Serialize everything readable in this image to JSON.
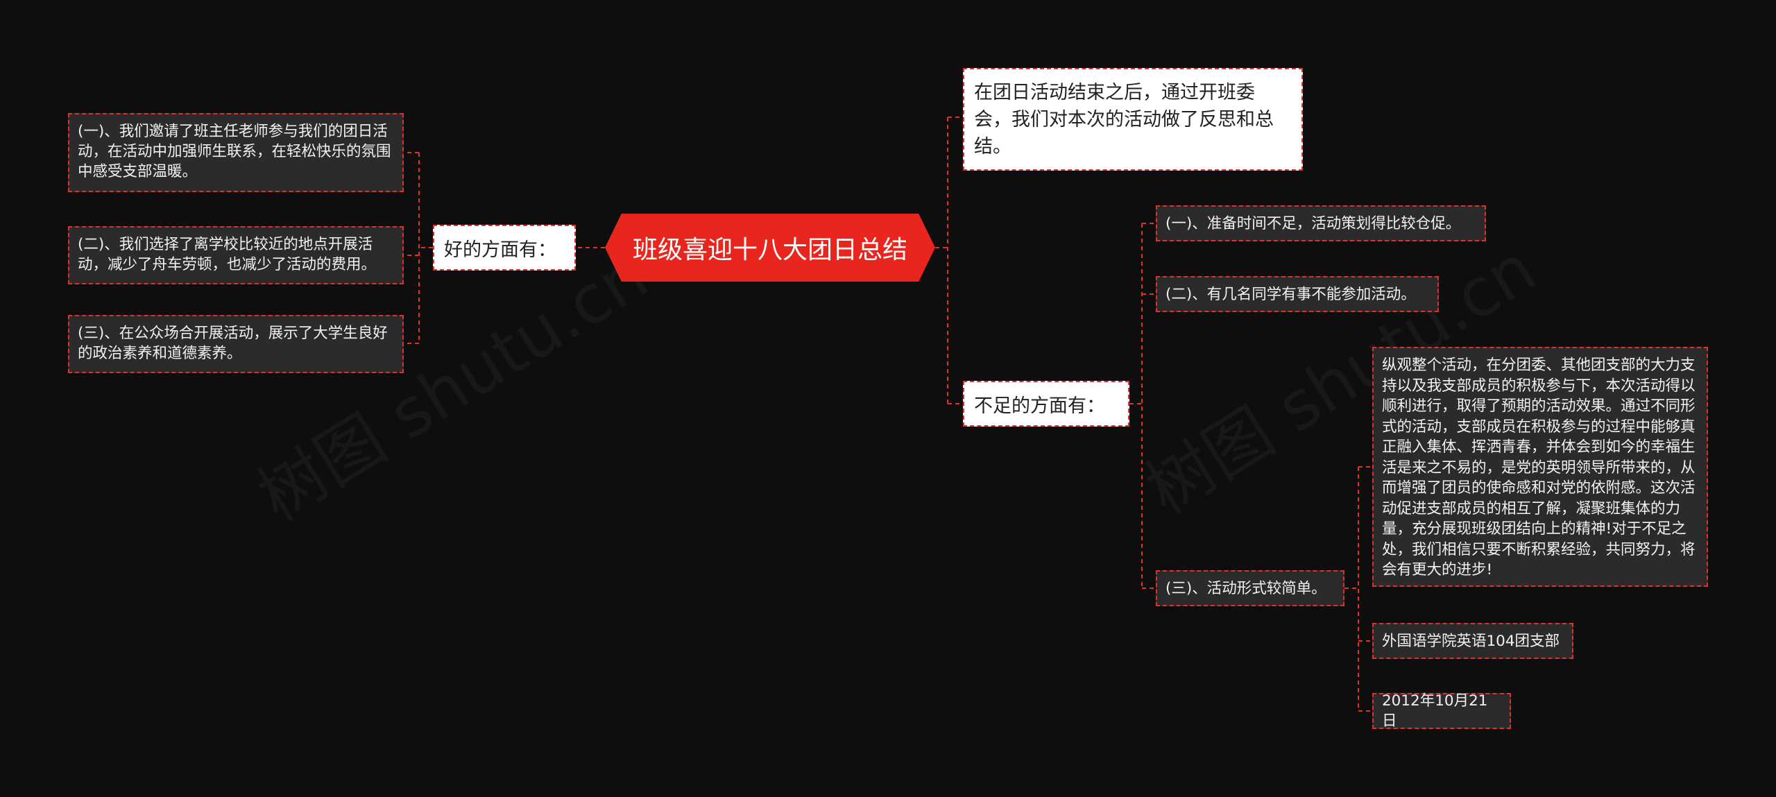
{
  "root": {
    "label": "班级喜迎十八大团日总结"
  },
  "good": {
    "label": "好的方面有：",
    "items": [
      "(一)、我们邀请了班主任老师参与我们的团日活动，在活动中加强师生联系，在轻松快乐的氛围中感受支部温暖。",
      "(二)、我们选择了离学校比较近的地点开展活动，减少了舟车劳顿，也减少了活动的费用。",
      "(三)、在公众场合开展活动，展示了大学生良好的政治素养和道德素养。"
    ]
  },
  "intro": {
    "label": "在团日活动结束之后，通过开班委会，我们对本次的活动做了反思和总结。"
  },
  "bad": {
    "label": "不足的方面有：",
    "items": [
      "(一)、准备时间不足，活动策划得比较仓促。",
      "(二)、有几名同学有事不能参加活动。",
      "(三)、活动形式较简单。"
    ],
    "details": [
      "纵观整个活动，在分团委、其他团支部的大力支持以及我支部成员的积极参与下，本次活动得以顺利进行，取得了预期的活动效果。通过不同形式的活动，支部成员在积极参与的过程中能够真正融入集体、挥洒青春，并体会到如今的幸福生活是来之不易的，是党的英明领导所带来的，从而增强了团员的使命感和对党的依附感。这次活动促进支部成员的相互了解，凝聚班集体的力量，充分展现班级团结向上的精神!对于不足之处，我们相信只要不断积累经验，共同努力，将会有更大的进步!",
      "外国语学院英语104团支部",
      "2012年10月21日"
    ]
  },
  "watermark": [
    "树图 shutu.cn",
    "树图 shutu.cn"
  ],
  "colors": {
    "background": "#0e0e0e",
    "accent": "#e8261e",
    "leaf_bg": "#2b2b2b"
  }
}
